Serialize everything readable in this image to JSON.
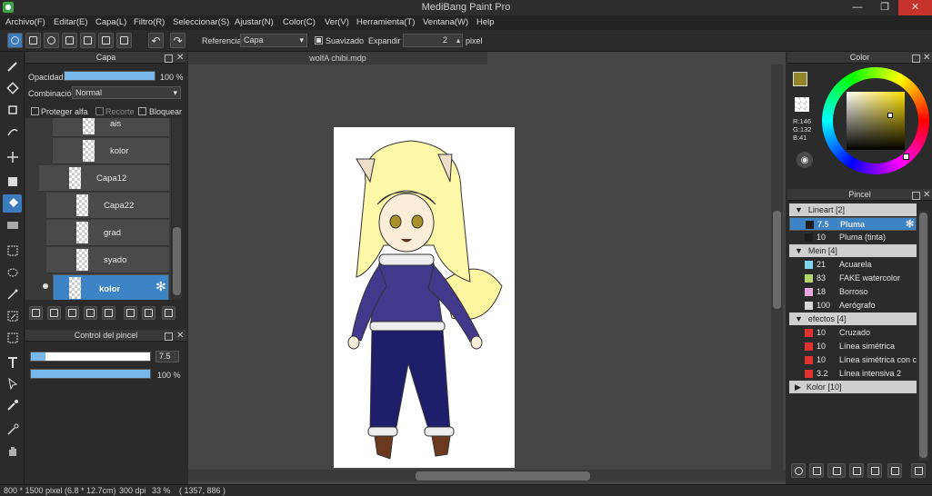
{
  "window": {
    "title": "MediBang Paint Pro",
    "minimize": "—",
    "maximize": "❐",
    "close": "✕"
  },
  "menu": [
    "Archivo(F)",
    "Editar(E)",
    "Capa(L)",
    "Filtro(R)",
    "Seleccionar(S)",
    "Ajustar(N)",
    "Color(C)",
    "Ver(V)",
    "Herramienta(T)",
    "Ventana(W)",
    "Help"
  ],
  "toolbar": {
    "referencia_label": "Referencia",
    "referencia_value": "Capa",
    "suavizado_label": "Suavizado",
    "suavizado_checked": true,
    "expandir_label": "Expandir",
    "expandir_value": "2",
    "unit": "pixel"
  },
  "layers_panel": {
    "title": "Capa",
    "opacity_label": "Opacidad",
    "opacity_value": "100 %",
    "opacity_fraction": 1.0,
    "blend_label": "Combinación",
    "blend_value": "Normal",
    "protect_alpha": "Proteger alfa",
    "clip": "Recorte",
    "lock": "Bloquear",
    "layers": [
      {
        "name": "ais"
      },
      {
        "name": "kolor"
      },
      {
        "name": "Capa12"
      },
      {
        "name": "Capa22"
      },
      {
        "name": "grad"
      },
      {
        "name": "syado"
      },
      {
        "name": "kolor",
        "selected": true
      }
    ]
  },
  "brush_control": {
    "title": "Control del pincel",
    "size_value": "7.5",
    "size_fraction": 0.12,
    "opacity_value": "100 %",
    "opacity_fraction": 1.0
  },
  "document": {
    "tab_name": "wolfA chibi.mdp"
  },
  "color_panel": {
    "title": "Color",
    "r": "R:146",
    "g": "G:132",
    "b": "B:41",
    "foreground": "#928429",
    "background": "#ffffff"
  },
  "brush_panel": {
    "title": "Pincel",
    "groups": [
      {
        "name": "Lineart [2]",
        "items": [
          {
            "size": "7.5",
            "name": "Pluma",
            "color": "#1e1e1e",
            "selected": true
          },
          {
            "size": "10",
            "name": "Pluma (tinta)",
            "color": "#1e1e1e"
          }
        ]
      },
      {
        "name": "Mein [4]",
        "items": [
          {
            "size": "21",
            "name": "Acuarela",
            "color": "#7fd6ee"
          },
          {
            "size": "83",
            "name": "FAKE watercolor",
            "color": "#b6d66e"
          },
          {
            "size": "18",
            "name": "Borroso",
            "color": "#e7a8e0"
          },
          {
            "size": "100",
            "name": "Aerógrafo",
            "color": "#d8d8d8"
          }
        ]
      },
      {
        "name": "efectos [4]",
        "items": [
          {
            "size": "10",
            "name": "Cruzado",
            "color": "#e23232"
          },
          {
            "size": "10",
            "name": "Línea simétrica",
            "color": "#e23232"
          },
          {
            "size": "10",
            "name": "Línea simétrica con c",
            "color": "#e23232"
          },
          {
            "size": "3.2",
            "name": "Línea intensiva 2",
            "color": "#e23232"
          }
        ]
      },
      {
        "name": "Kolor [10]",
        "items": []
      }
    ]
  },
  "status": {
    "size": "800 * 1500 pixel",
    "physical": "(6.8 * 12.7cm)",
    "dpi": "300 dpi",
    "zoom": "33 %",
    "coords": "( 1357, 886 )"
  }
}
